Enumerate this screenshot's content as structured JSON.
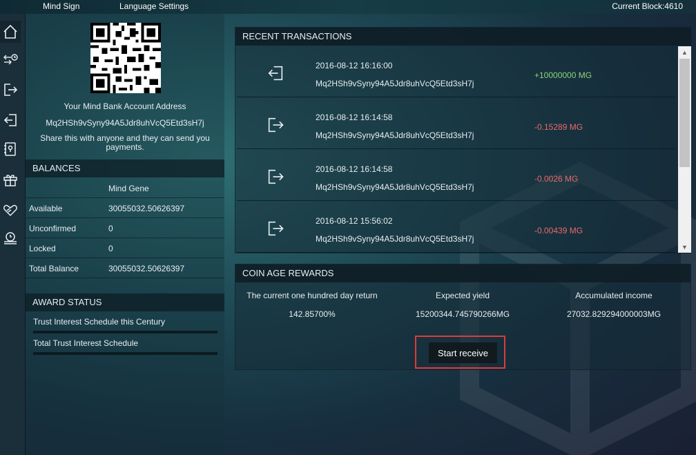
{
  "topbar": {
    "menu": [
      "Mind Sign",
      "Language Settings"
    ],
    "current_block": "Current Block:4610"
  },
  "sidenav": {
    "items": [
      {
        "icon": "home-icon",
        "active": true
      },
      {
        "icon": "transfer-history-icon"
      },
      {
        "icon": "send-icon"
      },
      {
        "icon": "receive-icon"
      },
      {
        "icon": "address-book-icon"
      },
      {
        "icon": "gift-icon"
      },
      {
        "icon": "heart-hand-icon"
      },
      {
        "icon": "coins-icon"
      }
    ]
  },
  "account": {
    "title": "Your Mind Bank Account Address",
    "address": "Mq2HSh9vSyny94A5Jdr8uhVcQ5Etd3sH7j",
    "share_text": "Share this with anyone and they can send you payments."
  },
  "balances": {
    "heading": "BALANCES",
    "column_header": "Mind Gene",
    "rows": [
      {
        "label": "Available",
        "value": "30055032.50626397"
      },
      {
        "label": "Unconfirmed",
        "value": "0"
      },
      {
        "label": "Locked",
        "value": "0"
      },
      {
        "label": "Total Balance",
        "value": "30055032.50626397"
      }
    ]
  },
  "award_status": {
    "heading": "AWARD STATUS",
    "items": [
      "Trust Interest Schedule this Century",
      "Total Trust Interest Schedule"
    ]
  },
  "transactions": {
    "heading": "RECENT TRANSACTIONS",
    "rows": [
      {
        "direction": "in",
        "icon": "receive-icon",
        "date": "2016-08-12 16:16:00",
        "address": "Mq2HSh9vSyny94A5Jdr8uhVcQ5Etd3sH7j",
        "amount": "+10000000 MG"
      },
      {
        "direction": "out",
        "icon": "send-icon",
        "date": "2016-08-12 16:14:58",
        "address": "Mq2HSh9vSyny94A5Jdr8uhVcQ5Etd3sH7j",
        "amount": "-0.15289 MG"
      },
      {
        "direction": "out",
        "icon": "send-icon",
        "date": "2016-08-12 16:14:58",
        "address": "Mq2HSh9vSyny94A5Jdr8uhVcQ5Etd3sH7j",
        "amount": "-0.0026 MG"
      },
      {
        "direction": "out",
        "icon": "send-icon",
        "date": "2016-08-12 15:56:02",
        "address": "Mq2HSh9vSyny94A5Jdr8uhVcQ5Etd3sH7j",
        "amount": "-0.00439 MG"
      }
    ]
  },
  "coin_age": {
    "heading": "COIN AGE REWARDS",
    "labels": [
      "The current one hundred day return",
      "Expected yield",
      "Accumulated income"
    ],
    "values": [
      "142.85700%",
      "15200344.745790266MG",
      "27032.829294000003MG"
    ],
    "button_label": "Start receive"
  },
  "colors": {
    "positive": "#8fd47a",
    "negative": "#e86a6a",
    "highlight_border": "#e03a3a"
  }
}
